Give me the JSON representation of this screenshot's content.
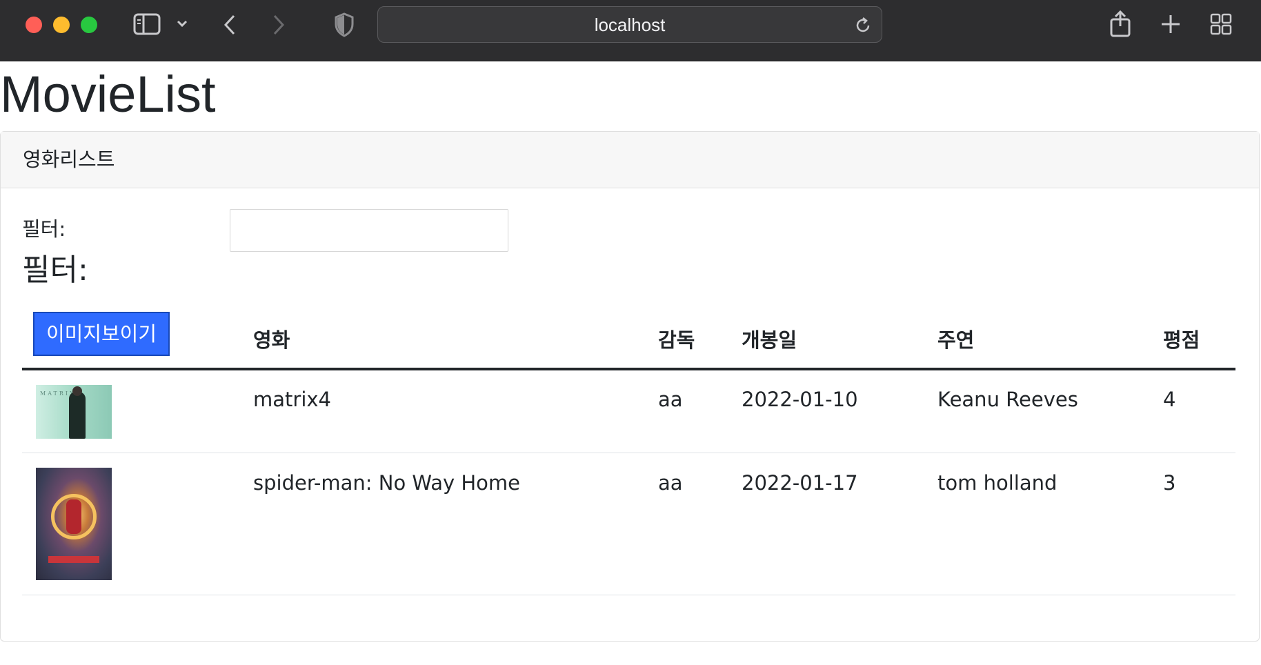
{
  "browser": {
    "url": "localhost"
  },
  "page": {
    "title": "MovieList",
    "card_header": "영화리스트",
    "filter_label": "필터:",
    "filter_value": "",
    "filter_echo": "필터:",
    "toggle_image_button": "이미지보이기"
  },
  "table": {
    "headers": {
      "title": "영화",
      "director": "감독",
      "release_date": "개봉일",
      "actor": "주연",
      "rating": "평점"
    },
    "rows": [
      {
        "poster": "matrix-poster",
        "title": "matrix4",
        "director": "aa",
        "release_date": "2022-01-10",
        "actor": "Keanu Reeves",
        "rating": "4"
      },
      {
        "poster": "spiderman-poster",
        "title": "spider-man: No Way Home",
        "director": "aa",
        "release_date": "2022-01-17",
        "actor": "tom holland",
        "rating": "3"
      }
    ]
  },
  "colors": {
    "button_bg": "#2f6bff",
    "chrome_bg": "#2d2d2f"
  }
}
